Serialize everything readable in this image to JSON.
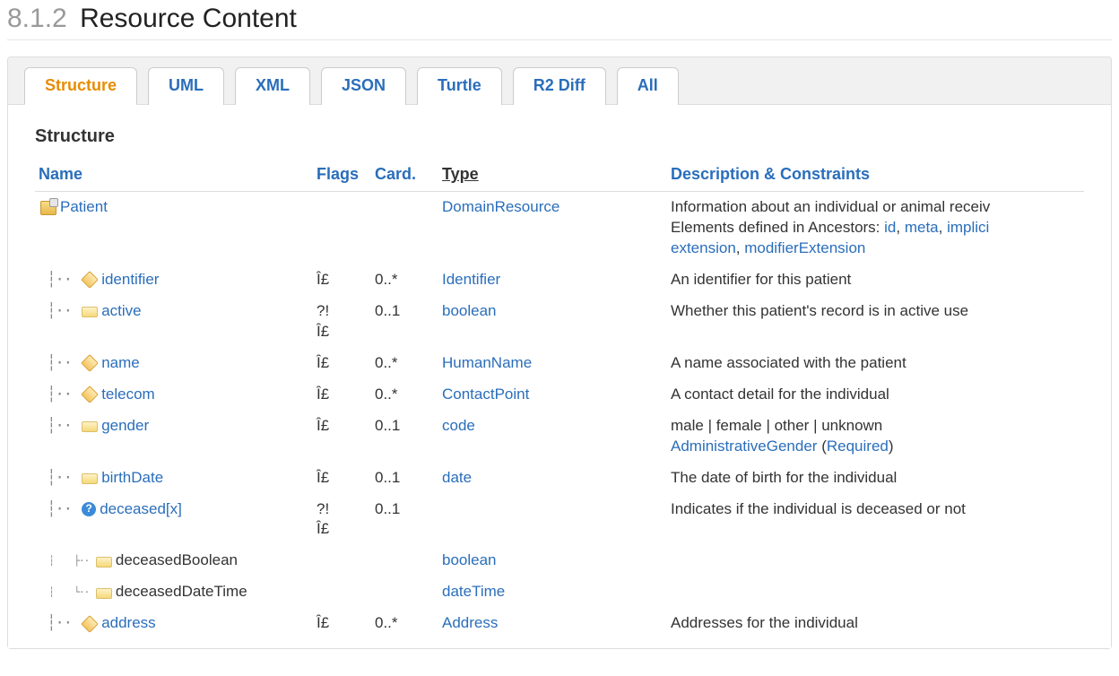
{
  "heading": {
    "number": "8.1.2",
    "title": "Resource Content"
  },
  "tabs": [
    {
      "label": "Structure",
      "active": true
    },
    {
      "label": "UML"
    },
    {
      "label": "XML"
    },
    {
      "label": "JSON"
    },
    {
      "label": "Turtle"
    },
    {
      "label": "R2 Diff"
    },
    {
      "label": "All"
    }
  ],
  "subtitle": "Structure",
  "columns": {
    "name": "Name",
    "flags": "Flags",
    "card": "Card.",
    "type": "Type",
    "desc": "Description & Constraints"
  },
  "root": {
    "name": "Patient",
    "type": "DomainResource",
    "descLead": "Information about an individual or animal receiv",
    "ancestorsLead": "Elements defined in Ancestors: ",
    "ancestorLinks": [
      "id",
      "meta",
      "implici"
    ],
    "ancestorLinks2": [
      "extension",
      "modifierExtension"
    ]
  },
  "rows": [
    {
      "icon": "obj",
      "depth": 1,
      "name": "identifier",
      "flag": "Î£",
      "card": "0..*",
      "typeLink": "Identifier",
      "desc": "An identifier for this patient"
    },
    {
      "icon": "prim",
      "depth": 1,
      "name": "active",
      "flag": "?!\nÎ£",
      "card": "0..1",
      "typeLink": "boolean",
      "desc": "Whether this patient's record is in active use"
    },
    {
      "icon": "obj",
      "depth": 1,
      "name": "name",
      "flag": "Î£",
      "card": "0..*",
      "typeLink": "HumanName",
      "desc": "A name associated with the patient"
    },
    {
      "icon": "obj",
      "depth": 1,
      "name": "telecom",
      "flag": "Î£",
      "card": "0..*",
      "typeLink": "ContactPoint",
      "desc": "A contact detail for the individual"
    },
    {
      "icon": "prim",
      "depth": 1,
      "name": "gender",
      "flag": "Î£",
      "card": "0..1",
      "typeLink": "code",
      "desc": "male | female | other | unknown",
      "binding": "AdministrativeGender",
      "bindingStrength": "Required"
    },
    {
      "icon": "prim",
      "depth": 1,
      "name": "birthDate",
      "flag": "Î£",
      "card": "0..1",
      "typeLink": "date",
      "desc": "The date of birth for the individual"
    },
    {
      "icon": "choice",
      "depth": 1,
      "name": "deceased[x]",
      "flag": "?!\nÎ£",
      "card": "0..1",
      "typeLink": "",
      "desc": "Indicates if the individual is deceased or not"
    },
    {
      "icon": "prim",
      "depth": 2,
      "name": "deceasedBoolean",
      "nolink": true,
      "flag": "",
      "card": "",
      "typeLink": "boolean",
      "desc": ""
    },
    {
      "icon": "prim",
      "depth": 2,
      "last": true,
      "name": "deceasedDateTime",
      "nolink": true,
      "flag": "",
      "card": "",
      "typeLink": "dateTime",
      "desc": ""
    },
    {
      "icon": "obj",
      "depth": 1,
      "name": "address",
      "flag": "Î£",
      "card": "0..*",
      "typeLink": "Address",
      "desc": "Addresses for the individual"
    }
  ]
}
